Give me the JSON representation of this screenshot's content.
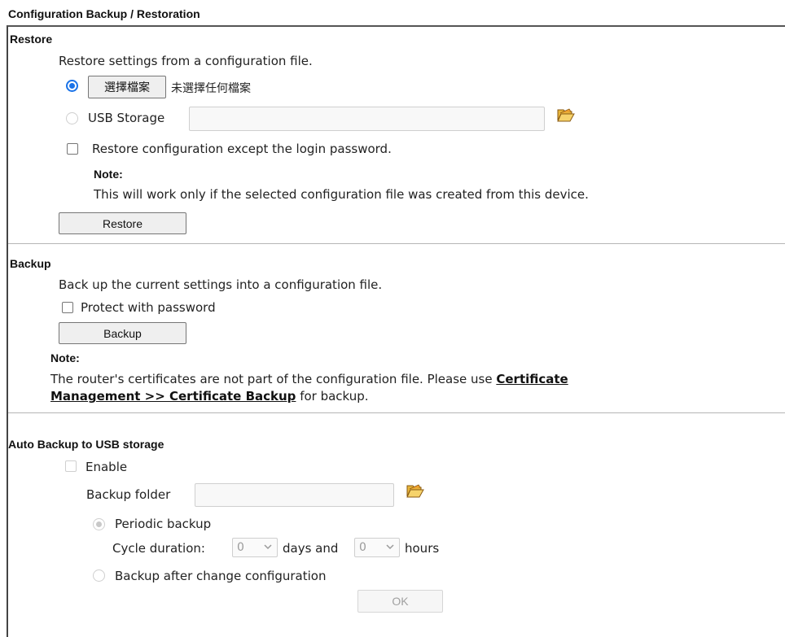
{
  "page_title": "Configuration Backup / Restoration",
  "restore": {
    "heading": "Restore",
    "description": "Restore settings from a configuration file.",
    "choose_file_button": "選擇檔案",
    "no_file_text": "未選擇任何檔案",
    "usb_storage_label": "USB Storage",
    "usb_storage_value": "",
    "except_password_label": "Restore configuration except the login password.",
    "note_label": "Note:",
    "note_text": "This will work only if the selected configuration file was created from this device.",
    "restore_button": "Restore"
  },
  "backup": {
    "heading": "Backup",
    "description": "Back up the current settings into a configuration file.",
    "protect_label": "Protect with password",
    "backup_button": "Backup",
    "note_label": "Note:",
    "note_text_before": "The router's certificates are not part of the configuration file. Please use ",
    "note_link_line1": "Certificate",
    "note_link_line2": "Management >> Certificate Backup",
    "note_text_after": " for backup."
  },
  "auto_backup": {
    "heading": "Auto Backup to USB storage",
    "enable_label": "Enable",
    "folder_label": "Backup folder",
    "folder_value": "",
    "periodic_label": "Periodic backup",
    "cycle_label": "Cycle duration:",
    "days_value": "0",
    "days_label": "days and",
    "hours_value": "0",
    "hours_label": "hours",
    "after_change_label": "Backup after change configuration",
    "ok_button": "OK"
  },
  "colors": {
    "accent": "#1a73e8",
    "border": "#444444",
    "separator": "#b5b5b5"
  },
  "icons": {
    "folder": "open-folder-icon",
    "chevron": "chevron-down-icon"
  }
}
